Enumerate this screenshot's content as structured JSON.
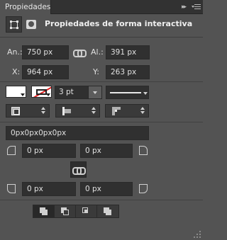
{
  "header": {
    "tab_label": "Propiedades",
    "collapse_glyph": "▸▸"
  },
  "title": "Propiedades de forma interactiva",
  "transform": {
    "width_label": "An.:",
    "width_value": "750 px",
    "height_label": "Al.:",
    "height_value": "391 px",
    "x_label": "X:",
    "x_value": "964 px",
    "y_label": "Y:",
    "y_value": "263 px"
  },
  "stroke": {
    "fill_color": "#ffffff",
    "stroke_color": "#e02020",
    "width_value": "3 pt",
    "line_style": "solid"
  },
  "radius": {
    "all_value": "0px0px0px0px",
    "top_left": "0 px",
    "top_right": "0 px",
    "bottom_left": "0 px",
    "bottom_right": "0 px"
  },
  "icons": {
    "mask": "mask-icon",
    "shape_select": "shape-select-icon",
    "link": "link-icon",
    "panel_menu": "menu-icon"
  },
  "path_ops": {
    "active_index": 0
  },
  "colors": {
    "panel_bg": "#535353",
    "titlebar_bg": "#323232",
    "field_bg": "#303030"
  }
}
